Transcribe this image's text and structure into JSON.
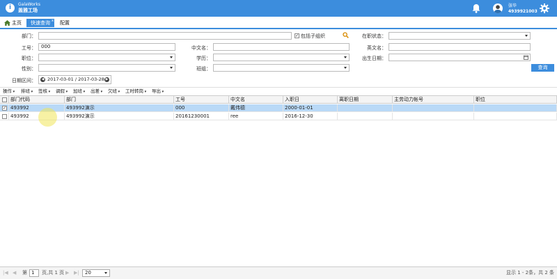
{
  "header": {
    "logo_en": "GalaWorks",
    "logo_cn": "盖雅工场",
    "user_name": "张华",
    "user_id": "4939921003"
  },
  "tabs": {
    "home": "主页",
    "quick_query": "快速查询",
    "config": "配置",
    "close": "x"
  },
  "form": {
    "dept_label": "部门：",
    "include_sub_label": "包括子组织",
    "status_label": "在职状态：",
    "emp_no_label": "工号：",
    "emp_no_value": "000",
    "cn_name_label": "中文名：",
    "en_name_label": "英文名：",
    "position_label": "职位：",
    "education_label": "学历：",
    "birth_label": "出生日期：",
    "gender_label": "性别：",
    "shift_label": "班组：",
    "date_range_label": "日期区间：",
    "date_range_value": "2017-03-01 / 2017-03-28",
    "query_button": "查询"
  },
  "toolbar": [
    "操作",
    "排班",
    "签核",
    "调假",
    "加班",
    "出差",
    "欠班",
    "工时转岗",
    "导出"
  ],
  "grid": {
    "columns": [
      "部门代码",
      "部门",
      "工号",
      "中文名",
      "入职日",
      "离职日期",
      "主劳动力帐号",
      "职位"
    ],
    "rows": [
      {
        "checked": "✓",
        "cells": [
          "493992",
          "493992演示",
          "000",
          "戴伟德",
          "2000-01-01",
          "",
          "",
          ""
        ]
      },
      {
        "checked": "",
        "cells": [
          "493992",
          "493992演示",
          "20161230001",
          "ree",
          "2016-12-30",
          "",
          "",
          ""
        ]
      }
    ]
  },
  "footer": {
    "page_prefix": "第",
    "page_value": "1",
    "page_suffix": "页,共 1 页",
    "page_size": "20",
    "summary": "显示 1 - 2条，共 2 条"
  },
  "colors": {
    "primary": "#3c8ddd",
    "selected_row": "#b9d9f7"
  }
}
